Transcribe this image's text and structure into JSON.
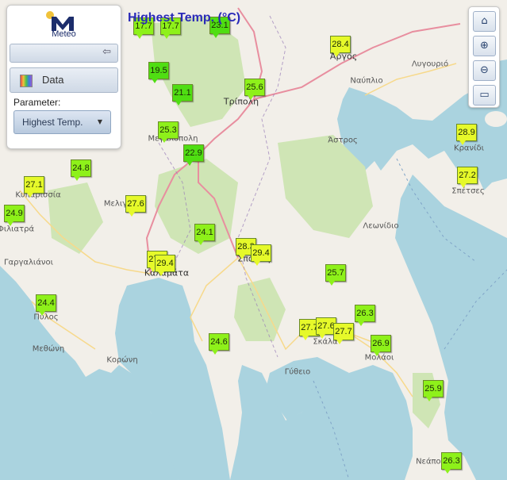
{
  "map_title": "Highest Temp. (°C)",
  "panel": {
    "logo_text": "Meteo",
    "data_button_label": "Data",
    "parameter_label": "Parameter:",
    "parameter_value": "Highest Temp."
  },
  "tools": {
    "home_icon": "home-icon",
    "zoom_in_icon": "zoom-in-icon",
    "zoom_out_icon": "zoom-out-icon",
    "fullscreen_icon": "fullscreen-icon"
  },
  "colors": {
    "sea": "#aad3df",
    "land": "#f2efe9",
    "forest": "#cfe5b5",
    "road_major": "#e88e9f",
    "road_minor": "#f7d98b",
    "border": "#9a7fb8",
    "marker_green": "#4fde12",
    "marker_lime": "#8ef11a",
    "marker_yellow": "#e6f92a",
    "title": "#2a2ab8"
  },
  "stations": [
    {
      "label": "17.7",
      "color": "lime"
    },
    {
      "label": "17.7",
      "color": "lime"
    },
    {
      "label": "23.1",
      "color": "green"
    },
    {
      "label": "28.4",
      "color": "yellow"
    },
    {
      "label": "19.5",
      "color": "green"
    },
    {
      "label": "21.1",
      "color": "green"
    },
    {
      "label": "25.6",
      "color": "lime"
    },
    {
      "label": "25.3",
      "color": "lime"
    },
    {
      "label": "22.9",
      "color": "green"
    },
    {
      "label": "28.9",
      "color": "yellow"
    },
    {
      "label": "27.2",
      "color": "yellow"
    },
    {
      "label": "24.8",
      "color": "lime"
    },
    {
      "label": "27.1",
      "color": "yellow"
    },
    {
      "label": "27.6",
      "color": "yellow"
    },
    {
      "label": "24.9",
      "color": "lime"
    },
    {
      "label": "24.1",
      "color": "lime"
    },
    {
      "label": "28.3",
      "color": "yellow"
    },
    {
      "label": "29.4",
      "color": "yellow"
    },
    {
      "label": "27.5",
      "color": "yellow"
    },
    {
      "label": "29.4",
      "color": "yellow"
    },
    {
      "label": "25.7",
      "color": "lime"
    },
    {
      "label": "24.4",
      "color": "lime"
    },
    {
      "label": "26.3",
      "color": "lime"
    },
    {
      "label": "27.7",
      "color": "yellow"
    },
    {
      "label": "27.6",
      "color": "yellow"
    },
    {
      "label": "27.7",
      "color": "yellow"
    },
    {
      "label": "26.9",
      "color": "lime"
    },
    {
      "label": "24.6",
      "color": "lime"
    },
    {
      "label": "25.9",
      "color": "lime"
    },
    {
      "label": "26.3",
      "color": "lime"
    }
  ],
  "places": [
    "Άργος",
    "Ναύπλιο",
    "Λυγουριό",
    "Τρίπολη",
    "Μεγαλόπολη",
    "Άστρος",
    "Κρανίδι",
    "Σπέτσες",
    "Κυπαρισσία",
    "Μελιγαλάς",
    "Φιλιατρά",
    "Λεωνίδιο",
    "Γαργαλιάνοι",
    "Σπάρτη",
    "Καλαμάτα",
    "Πύλος",
    "Σκάλα",
    "Μολάοι",
    "Μεθώνη",
    "Κορώνη",
    "Γύθειο",
    "Νεάπολη"
  ]
}
